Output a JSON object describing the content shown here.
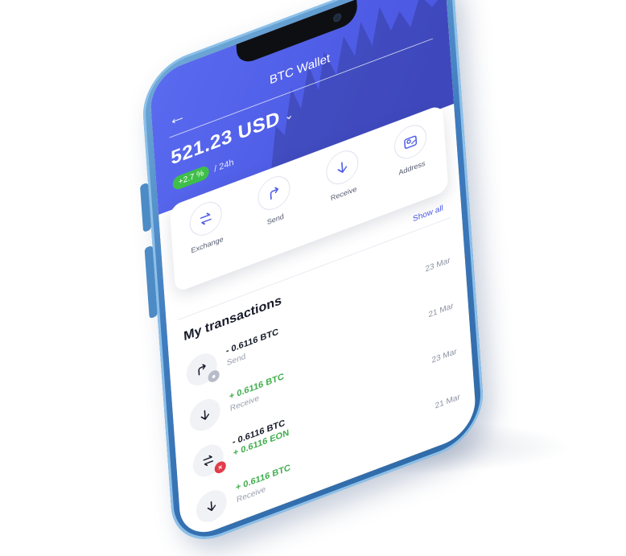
{
  "app": {
    "title": "BTC Wallet",
    "back_icon": "arrow-left-icon"
  },
  "balance": {
    "amount": "521.23 USD",
    "change": "+2.7 %",
    "period": "/ 24h"
  },
  "actions": [
    {
      "label": "Exchange",
      "icon": "exchange-icon"
    },
    {
      "label": "Send",
      "icon": "send-icon"
    },
    {
      "label": "Receive",
      "icon": "receive-icon"
    },
    {
      "label": "Address",
      "icon": "address-map-icon"
    }
  ],
  "transactions_section": {
    "show_all": "Show all",
    "title": "My transactions"
  },
  "transactions": [
    {
      "amount": "- 0.6116 BTC",
      "type": "Send",
      "date": "23 Mar",
      "icon": "send-icon",
      "status": "pending"
    },
    {
      "amount": "+ 0.6116 BTC",
      "type": "Receive",
      "date": "21 Mar",
      "icon": "receive-icon",
      "status": ""
    },
    {
      "amount": "- 0.6116 BTC",
      "amount2": "+ 0.6116 EON",
      "date": "23 Mar",
      "icon": "exchange-icon",
      "status": "failed"
    },
    {
      "amount": "+ 0.6116 BTC",
      "type": "Receive",
      "date": "21 Mar",
      "icon": "receive-icon",
      "status": ""
    }
  ],
  "colors": {
    "accent": "#4f5de6",
    "positive": "#3fae4d",
    "negative": "#e23b4a",
    "phone_body": "#3f7cc0"
  }
}
